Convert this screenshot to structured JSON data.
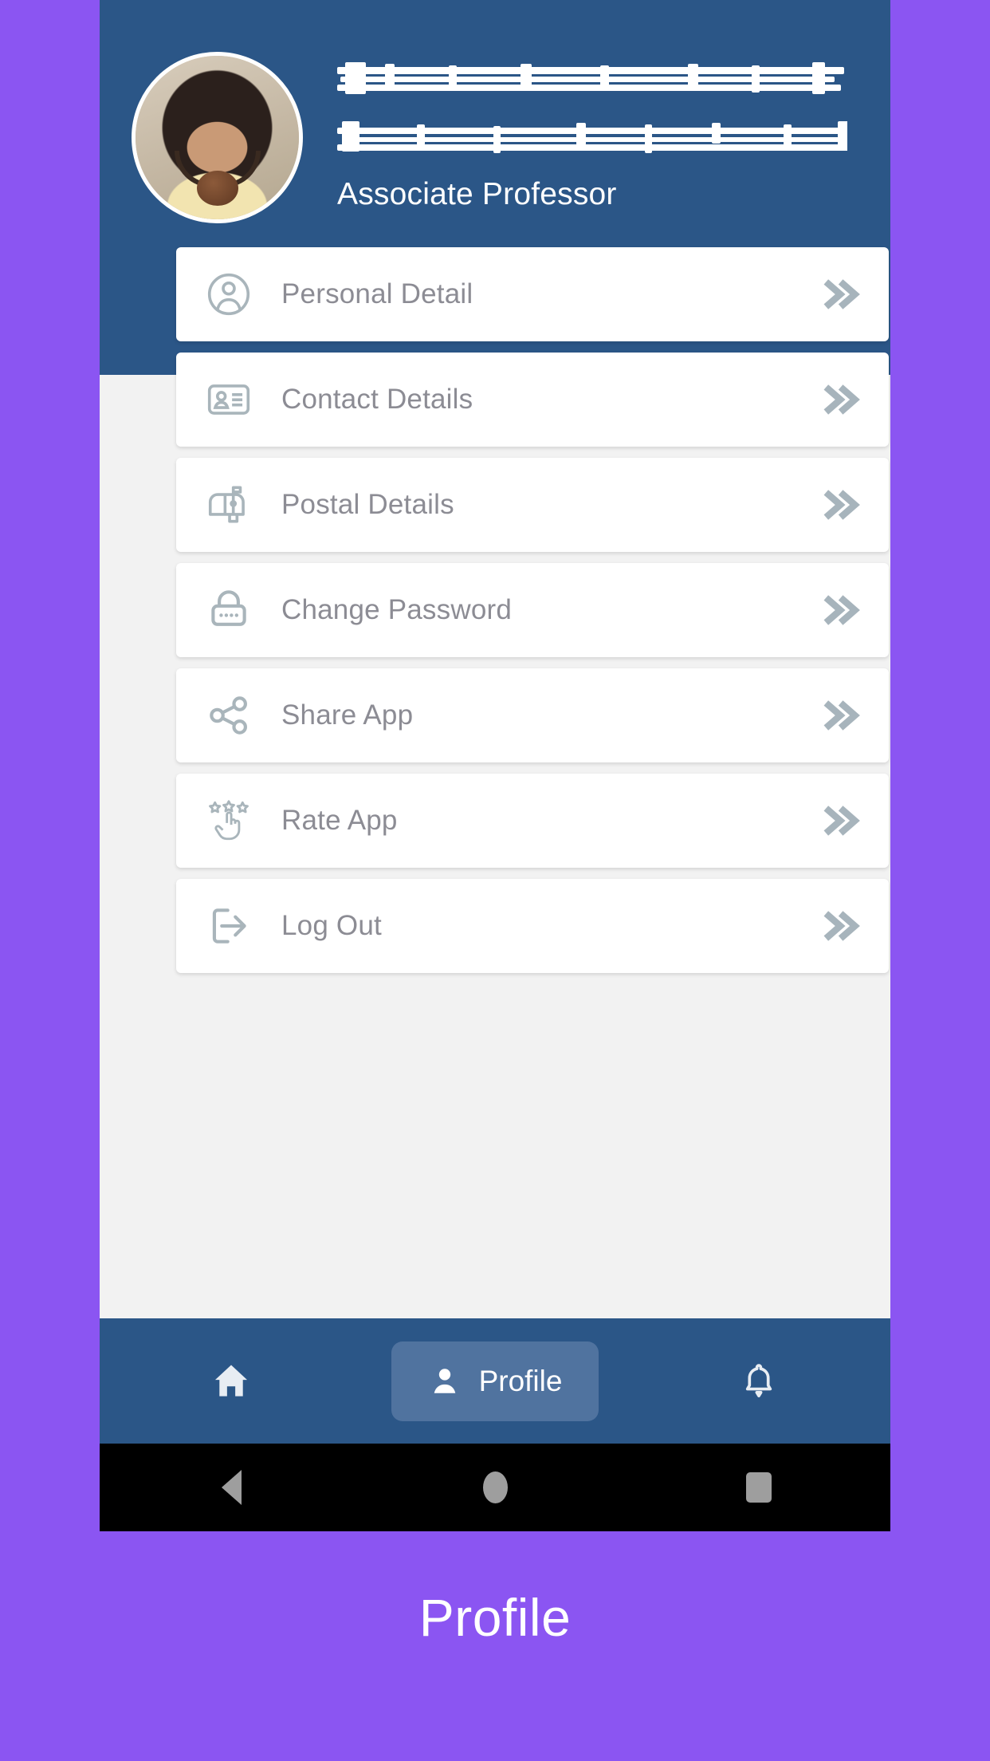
{
  "theme": {
    "page_background": "#8B55F2",
    "header_background": "#2B5687",
    "content_background": "#F2F2F2",
    "card_background": "#FFFFFF",
    "label_color": "#8C8C94",
    "chevron_color": "#A7B4BC",
    "icon_color": "#A9B5BB",
    "navbar_background": "#2B5687",
    "active_pill_background": "#50739F",
    "system_bar_background": "#000000",
    "system_icon_color": "#9E9E9E"
  },
  "header": {
    "avatar": "profile-photo",
    "name": "",
    "name_state": "redacted",
    "email": "",
    "email_state": "redacted",
    "role": "Associate Professor"
  },
  "menu": {
    "items": [
      {
        "label": "Personal Detail",
        "icon": "person-circle-icon",
        "chevron": "double-chevron-right-icon"
      },
      {
        "label": "Contact Details",
        "icon": "id-card-icon",
        "chevron": "double-chevron-right-icon"
      },
      {
        "label": "Postal Details",
        "icon": "mailbox-icon",
        "chevron": "double-chevron-right-icon"
      },
      {
        "label": "Change Password",
        "icon": "padlock-icon",
        "chevron": "double-chevron-right-icon"
      },
      {
        "label": "Share App",
        "icon": "share-nodes-icon",
        "chevron": "double-chevron-right-icon"
      },
      {
        "label": "Rate App",
        "icon": "rate-stars-hand-icon",
        "chevron": "double-chevron-right-icon"
      },
      {
        "label": "Log Out",
        "icon": "logout-arrow-icon",
        "chevron": "double-chevron-right-icon"
      }
    ]
  },
  "bottom_nav": {
    "items": [
      {
        "label": "",
        "icon": "home-icon",
        "active": false
      },
      {
        "label": "Profile",
        "icon": "person-icon",
        "active": true
      },
      {
        "label": "",
        "icon": "bell-icon",
        "active": false
      }
    ]
  },
  "system_bar": {
    "back": "back-triangle-icon",
    "home": "home-circle-icon",
    "recents": "recents-square-icon"
  },
  "caption": {
    "text": "Profile"
  }
}
